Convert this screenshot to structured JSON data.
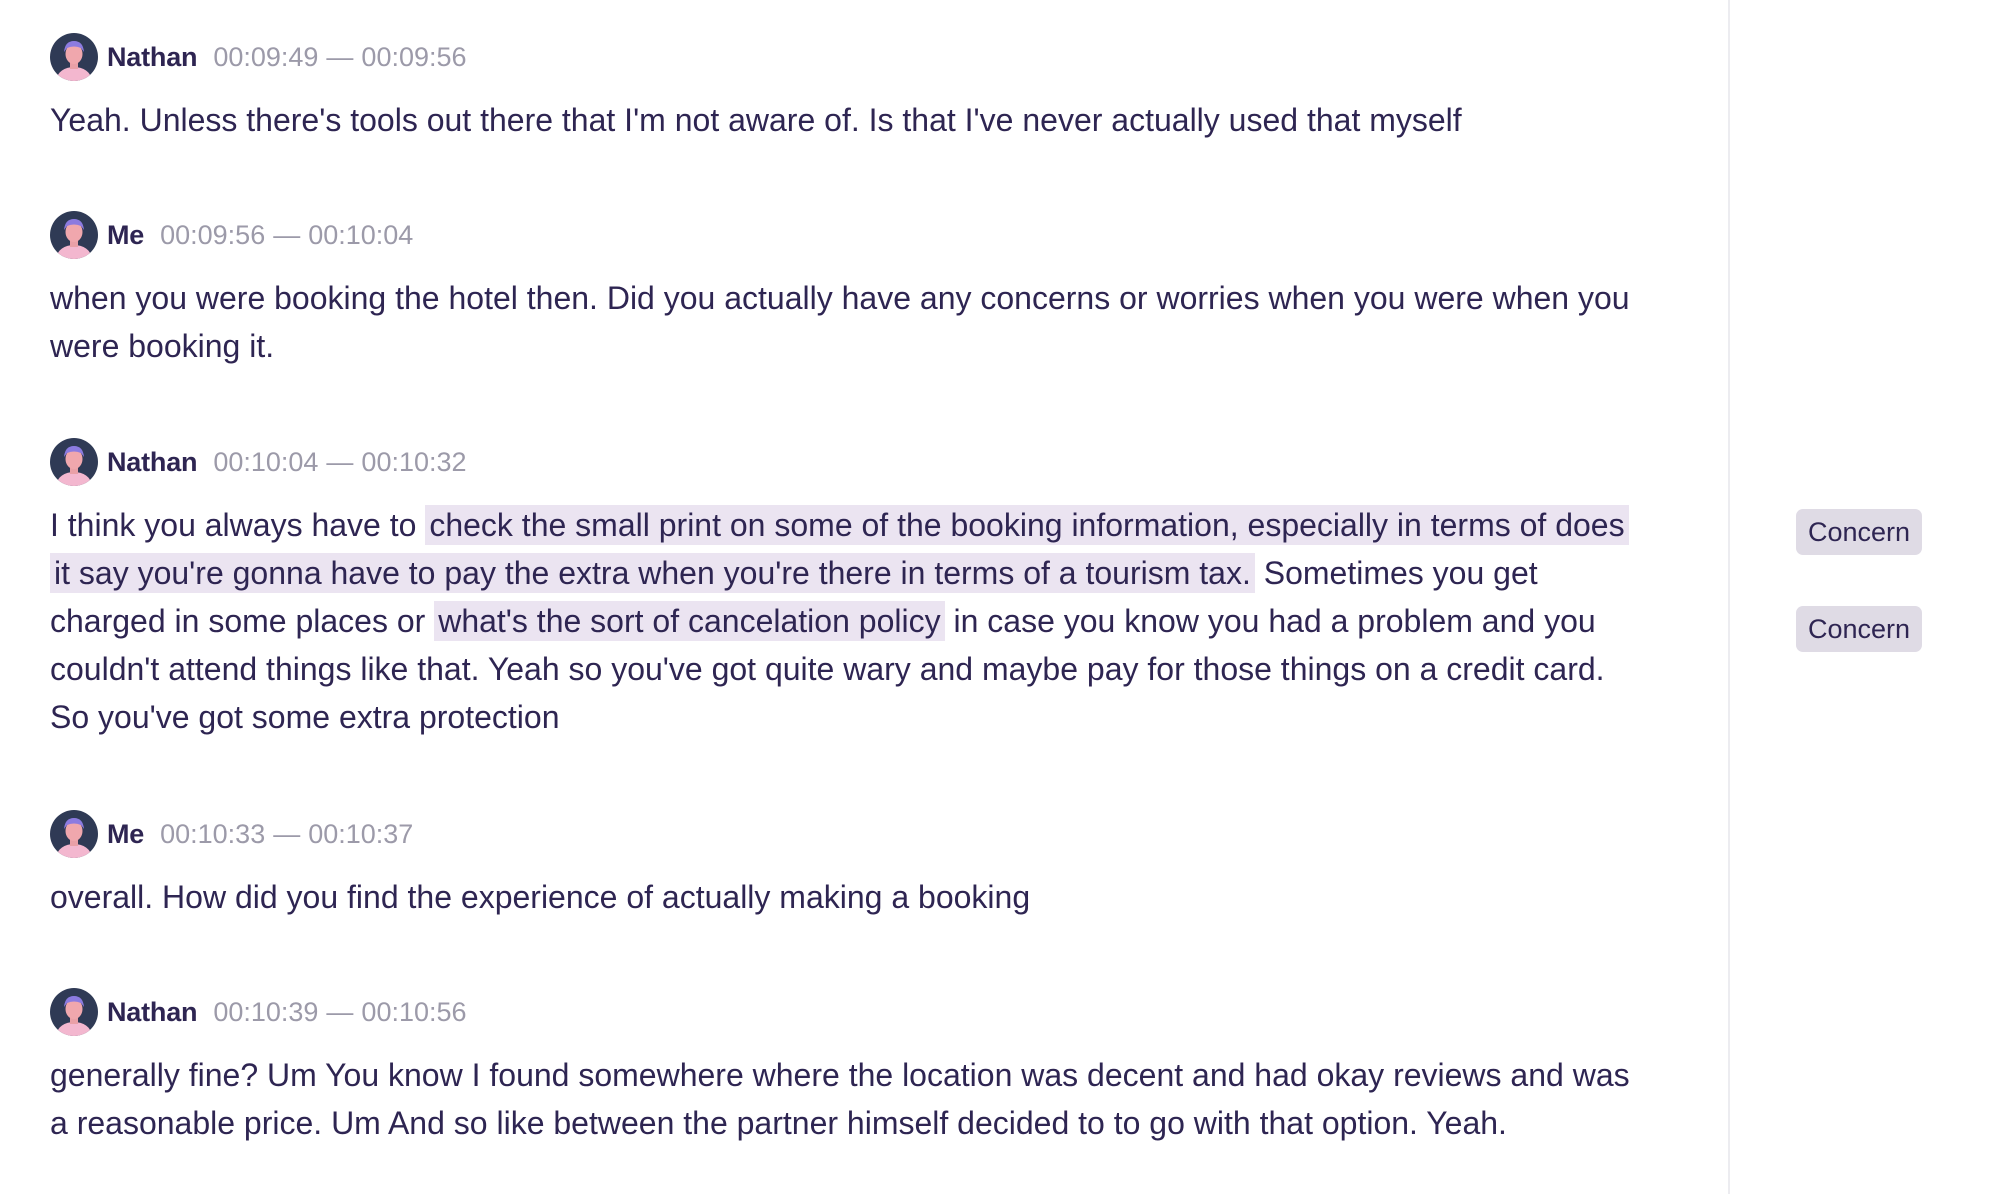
{
  "transcript": {
    "entries": [
      {
        "speaker": "Nathan",
        "start": "00:09:49",
        "end": "00:09:56",
        "text": "Yeah. Unless there's tools out there that I'm not aware of. Is that I've never actually used that myself"
      },
      {
        "speaker": "Me",
        "start": "00:09:56",
        "end": "00:10:04",
        "text": "when you were booking the hotel then. Did you actually have any concerns or worries when you were when you were booking it."
      },
      {
        "speaker": "Nathan",
        "start": "00:10:04",
        "end": "00:10:32",
        "segments": [
          "I think you always have to ",
          "check the small print on some of the booking information, especially in terms of does it say you're gonna have to pay the extra when you're there in terms of a tourism tax.",
          " Sometimes you get charged in some places or ",
          "what's the sort of cancelation policy",
          " in case you know you had a problem and you couldn't attend things like that. Yeah so you've got quite wary and maybe pay for those things on a credit card. So you've got some extra protection"
        ]
      },
      {
        "speaker": "Me",
        "start": "00:10:33",
        "end": "00:10:37",
        "text": "overall. How did you find the experience of actually making a booking"
      },
      {
        "speaker": "Nathan",
        "start": "00:10:39",
        "end": "00:10:56",
        "text": "generally fine? Um You know I found somewhere where the location was decent and had okay reviews and was a reasonable price. Um And so like between the partner himself decided to to go with that option. Yeah."
      }
    ],
    "range_separator": "—"
  },
  "tags": [
    {
      "label": "Concern"
    },
    {
      "label": "Concern"
    }
  ],
  "colors": {
    "text": "#2e2552",
    "timestamp": "#9c9aa9",
    "highlight": "#ebe4f1",
    "tag_bg": "#dfdbe5",
    "divider": "#ececf0"
  }
}
